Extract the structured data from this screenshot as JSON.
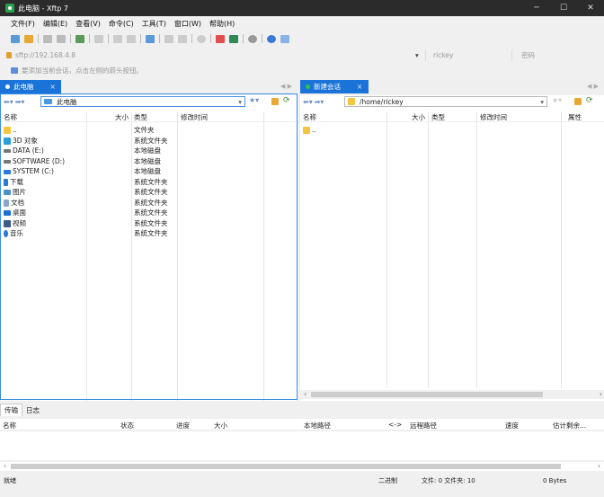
{
  "window": {
    "title": "此电脑 - Xftp 7",
    "minimize": "─",
    "maximize": "☐",
    "close": "✕"
  },
  "menu": [
    "文件(F)",
    "编辑(E)",
    "查看(V)",
    "命令(C)",
    "工具(T)",
    "窗口(W)",
    "帮助(H)"
  ],
  "address": {
    "url": "sftp://192.168.4.8",
    "user": "rickey",
    "password_placeholder": "密码"
  },
  "hint": "要添加当前会话，点击左侧的箭头按钮。",
  "left": {
    "tab_label": "此电脑",
    "tab_close": "×",
    "path": "此电脑",
    "columns": [
      "名称",
      "大小",
      "类型",
      "修改时间"
    ],
    "rows": [
      {
        "name": "..",
        "type": "文件夹",
        "icon": "folder-up-icon",
        "color": "#f5c542"
      },
      {
        "name": "3D 对象",
        "type": "系统文件夹",
        "icon": "3d-objects-icon",
        "color": "#2a9fd6"
      },
      {
        "name": "DATA (E:)",
        "type": "本地磁盘",
        "icon": "drive-icon",
        "color": "#666666"
      },
      {
        "name": "SOFTWARE (D:)",
        "type": "本地磁盘",
        "icon": "drive-icon",
        "color": "#666666"
      },
      {
        "name": "SYSTEM (C:)",
        "type": "本地磁盘",
        "icon": "system-drive-icon",
        "color": "#2a7ad6"
      },
      {
        "name": "下载",
        "type": "系统文件夹",
        "icon": "download-icon",
        "color": "#2a7ad6"
      },
      {
        "name": "图片",
        "type": "系统文件夹",
        "icon": "pictures-icon",
        "color": "#4a90c8"
      },
      {
        "name": "文档",
        "type": "系统文件夹",
        "icon": "documents-icon",
        "color": "#8aa6c8"
      },
      {
        "name": "桌面",
        "type": "系统文件夹",
        "icon": "desktop-icon",
        "color": "#1a6fd0"
      },
      {
        "name": "视频",
        "type": "系统文件夹",
        "icon": "videos-icon",
        "color": "#3a5a8a"
      },
      {
        "name": "音乐",
        "type": "系统文件夹",
        "icon": "music-icon",
        "color": "#2a7ad6"
      }
    ]
  },
  "right": {
    "tab_label": "新建会话",
    "tab_close": "×",
    "path": "/home/rickey",
    "columns": [
      "名称",
      "大小",
      "类型",
      "修改时间",
      "属性"
    ],
    "rows": [
      {
        "name": "..",
        "icon": "folder-up-icon",
        "color": "#f5c542"
      }
    ]
  },
  "transfer": {
    "tabs": [
      "传输",
      "日志"
    ],
    "columns": [
      "名称",
      "状态",
      "进度",
      "大小",
      "本地路径",
      "<->",
      "远程路径",
      "速度",
      "估计剩余..."
    ]
  },
  "status": {
    "ready": "就绪",
    "mode": "二进制",
    "counts": "文件: 0 文件夹: 10",
    "bytes": "0 Bytes"
  }
}
